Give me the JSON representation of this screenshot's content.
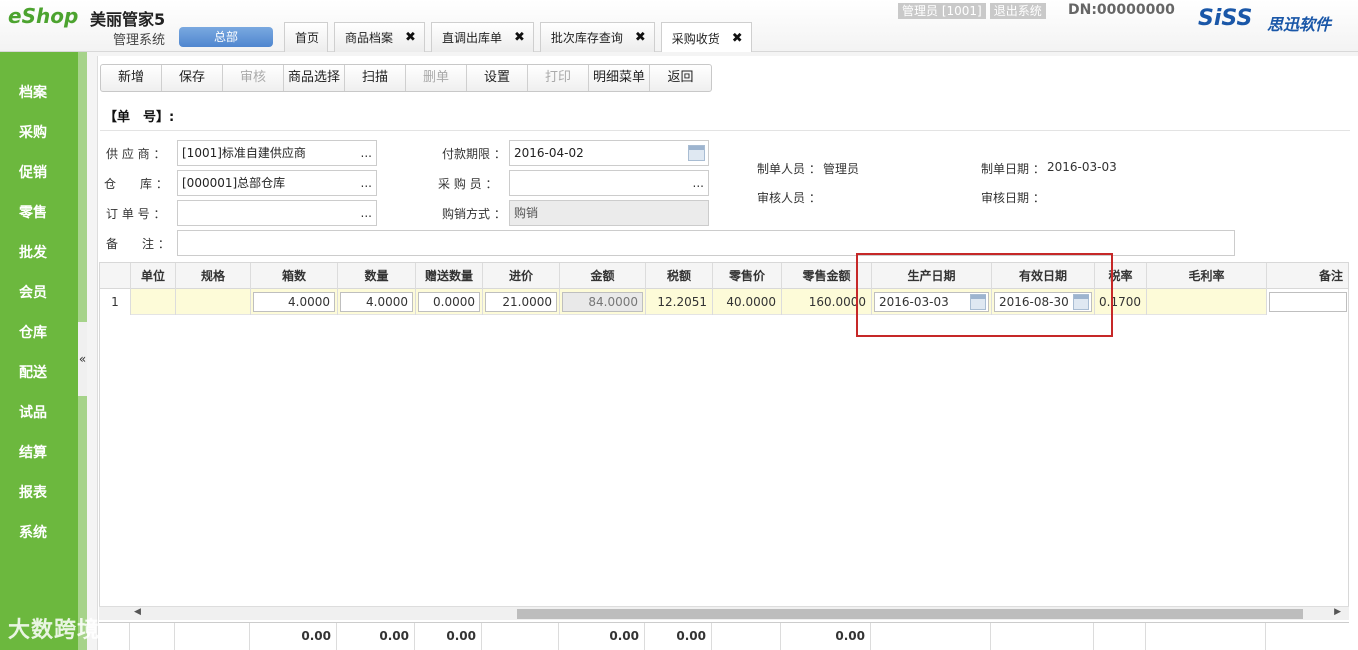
{
  "header": {
    "logo_brand": "eShop",
    "logo_product": "美丽管家5",
    "logo_system": "管理系统",
    "hq_button": "总部",
    "user_role": "管理员 [1001]",
    "logout": "退出系统",
    "dn": "DN:00000000",
    "vendor_logo": "SiSS",
    "vendor_name": "思迅软件"
  },
  "tabs": [
    {
      "label": "首页",
      "closable": false
    },
    {
      "label": "商品档案",
      "closable": true
    },
    {
      "label": "直调出库单",
      "closable": true
    },
    {
      "label": "批次库存查询",
      "closable": true
    },
    {
      "label": "采购收货",
      "closable": true,
      "active": true
    }
  ],
  "sidebar": {
    "items": [
      "档案",
      "采购",
      "促销",
      "零售",
      "批发",
      "会员",
      "仓库",
      "配送",
      "试品",
      "结算",
      "报表",
      "系统"
    ],
    "collapse_icon": "«"
  },
  "toolbar": {
    "buttons": [
      {
        "label": "新增",
        "enabled": true
      },
      {
        "label": "保存",
        "enabled": true
      },
      {
        "label": "审核",
        "enabled": false
      },
      {
        "label": "商品选择",
        "enabled": true
      },
      {
        "label": "扫描",
        "enabled": true
      },
      {
        "label": "删单",
        "enabled": false
      },
      {
        "label": "设置",
        "enabled": true
      },
      {
        "label": "打印",
        "enabled": false
      },
      {
        "label": "明细菜单",
        "enabled": true
      },
      {
        "label": "返回",
        "enabled": true
      }
    ]
  },
  "form": {
    "order_no_label": "【单　号】:",
    "supplier_label": "供 应 商 ：",
    "supplier_value": "[1001]标准自建供应商",
    "warehouse_label": "仓　　库 ：",
    "warehouse_value": "[000001]总部仓库",
    "order_label": "订 单 号 ：",
    "order_value": "",
    "remark_label": "备　　注 ：",
    "remark_value": "",
    "pay_term_label": "付款期限 ：",
    "pay_term_value": "2016-04-02",
    "buyer_label": "采 购 员 ：",
    "buyer_value": "",
    "trade_mode_label": "购销方式 ：",
    "trade_mode_value": "购销",
    "maker_label": "制单人员 ：",
    "maker_value": "管理员",
    "make_date_label": "制单日期 ：",
    "make_date_value": "2016-03-03",
    "auditor_label": "审核人员 ：",
    "auditor_value": "",
    "audit_date_label": "审核日期 ：",
    "audit_date_value": "",
    "ellipsis": "..."
  },
  "grid": {
    "columns": [
      "",
      "单位",
      "规格",
      "箱数",
      "数量",
      "赠送数量",
      "进价",
      "金额",
      "税额",
      "零售价",
      "零售金额",
      "生产日期",
      "有效日期",
      "税率",
      "毛利率",
      "备注"
    ],
    "rows": [
      {
        "no": "1",
        "unit": "",
        "spec": "",
        "boxes": "4.0000",
        "qty": "4.0000",
        "gift_qty": "0.0000",
        "price": "21.0000",
        "amount": "84.0000",
        "tax": "12.2051",
        "retail_price": "40.0000",
        "retail_amount": "160.0000",
        "prod_date": "2016-03-03",
        "exp_date": "2016-08-30",
        "tax_rate": "0.1700",
        "margin": "",
        "remark": ""
      }
    ],
    "footer": {
      "boxes": "0.00",
      "qty": "0.00",
      "gift_qty": "0.00",
      "amount": "0.00",
      "tax": "0.00",
      "retail_amount": "0.00"
    }
  },
  "watermark": "大数跨境",
  "colors": {
    "sidebar": "#6cb83e",
    "row_highlight": "#fdfbd8",
    "annotation_box": "#c62828",
    "vendor_blue": "#1a57a8"
  }
}
